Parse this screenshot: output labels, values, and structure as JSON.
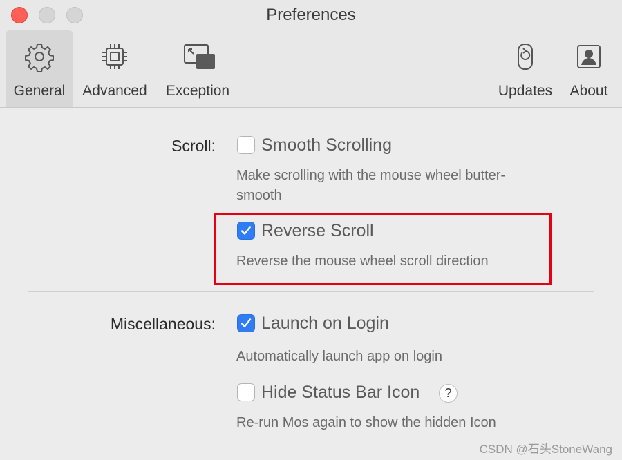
{
  "window": {
    "title": "Preferences"
  },
  "toolbar": {
    "tabs": [
      {
        "label": "General",
        "icon": "gear-icon",
        "selected": true
      },
      {
        "label": "Advanced",
        "icon": "chip-icon",
        "selected": false
      },
      {
        "label": "Exception",
        "icon": "window-exception-icon",
        "selected": false
      },
      {
        "label": "Updates",
        "icon": "update-icon",
        "selected": false
      },
      {
        "label": "About",
        "icon": "person-icon",
        "selected": false
      }
    ]
  },
  "scroll_section": {
    "label": "Scroll:",
    "options": [
      {
        "label": "Smooth Scrolling",
        "checked": false,
        "description": "Make scrolling with the mouse wheel butter-smooth"
      },
      {
        "label": "Reverse Scroll",
        "checked": true,
        "description": "Reverse the mouse wheel scroll direction"
      }
    ]
  },
  "misc_section": {
    "label": "Miscellaneous:",
    "options": [
      {
        "label": "Launch on Login",
        "checked": true,
        "description": "Automatically launch app on login"
      },
      {
        "label": "Hide Status Bar Icon",
        "checked": false,
        "description": "Re-run Mos again to show the hidden Icon",
        "help": "?"
      }
    ]
  },
  "colors": {
    "accent": "#2f7cf6",
    "highlight": "#e60012",
    "close_button": "#fe5f57"
  },
  "watermark": "CSDN @石头StoneWang"
}
